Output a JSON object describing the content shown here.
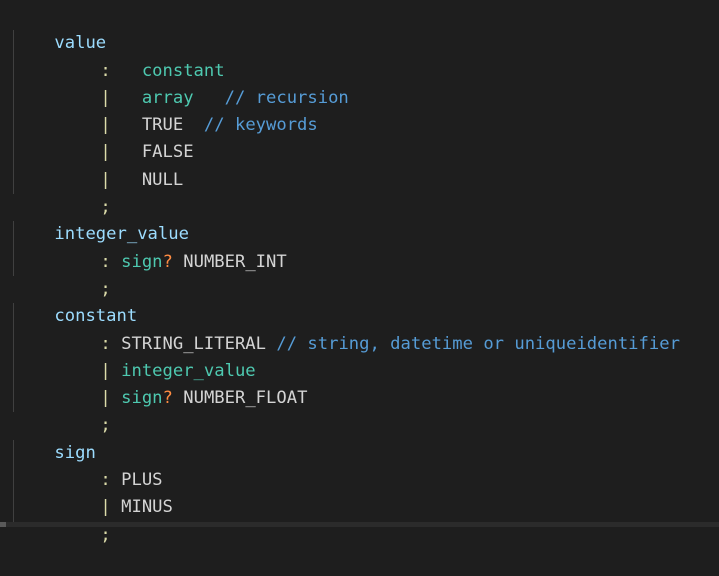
{
  "editor": {
    "language": "grammar",
    "colors": {
      "background": "#1e1e1e",
      "rule_name": "#9cdcfe",
      "rule_reference": "#4ec9b0",
      "terminal": "#d4d4d4",
      "punctuation": "#dcdcaa",
      "operator": "#ff8c42",
      "comment": "#569cd6"
    },
    "lines": [
      {
        "rule": "value"
      },
      {
        "punct": ":",
        "ref": "constant"
      },
      {
        "punct": "|",
        "ref": "array",
        "comment": "// recursion"
      },
      {
        "punct": "|",
        "term": "TRUE",
        "comment": "// keywords"
      },
      {
        "punct": "|",
        "term": "FALSE"
      },
      {
        "punct": "|",
        "term": "NULL"
      },
      {
        "punct": ";"
      },
      {
        "rule": "integer_value"
      },
      {
        "punct": ":",
        "ref": "sign",
        "op": "?",
        "term": "NUMBER_INT"
      },
      {
        "punct": ";"
      },
      {
        "rule": "constant"
      },
      {
        "punct": ":",
        "term": "STRING_LITERAL",
        "comment": "// string, datetime or uniqueidentifier"
      },
      {
        "punct": "|",
        "ref": "integer_value"
      },
      {
        "punct": "|",
        "ref": "sign",
        "op": "?",
        "term": "NUMBER_FLOAT"
      },
      {
        "punct": ";"
      },
      {
        "rule": "sign"
      },
      {
        "punct": ":",
        "term": "PLUS"
      },
      {
        "punct": "|",
        "term": "MINUS"
      },
      {
        "punct": ";"
      }
    ]
  }
}
